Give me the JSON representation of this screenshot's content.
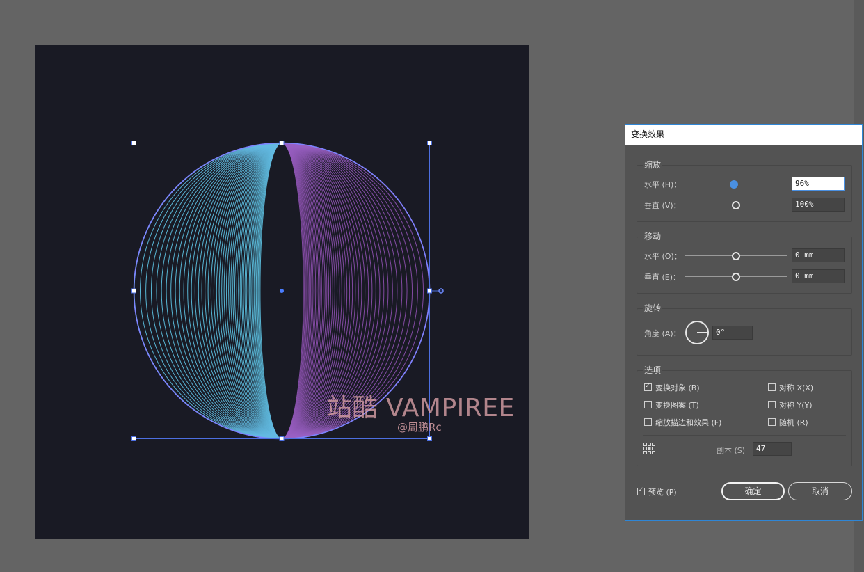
{
  "watermark": {
    "main": "站酷 VAMPIREE",
    "sub": "@周鹏Rc"
  },
  "dialog": {
    "title": "变换效果",
    "scale": {
      "title": "缩放",
      "horizontal": {
        "label": "水平 (H)：",
        "value": "96%"
      },
      "vertical": {
        "label": "垂直 (V)：",
        "value": "100%"
      }
    },
    "move": {
      "title": "移动",
      "horizontal": {
        "label": "水平 (O)：",
        "value": "0 mm"
      },
      "vertical": {
        "label": "垂直 (E)：",
        "value": "0 mm"
      }
    },
    "rotate": {
      "title": "旋转",
      "angle": {
        "label": "角度 (A)：",
        "value": "0°"
      }
    },
    "options": {
      "title": "选项",
      "transform_objects": {
        "label": "变换对象 (B)",
        "checked": true
      },
      "transform_patterns": {
        "label": "变换图案 (T)",
        "checked": false
      },
      "scale_strokes": {
        "label": "缩放描边和效果 (F)",
        "checked": false
      },
      "reflect_x": {
        "label": "对称 X(X)",
        "checked": false
      },
      "reflect_y": {
        "label": "对称 Y(Y)",
        "checked": false
      },
      "random": {
        "label": "随机 (R)",
        "checked": false
      },
      "copies": {
        "label": "副本 (S)",
        "value": "47"
      }
    },
    "preview": {
      "label": "预览 (P)",
      "checked": true
    },
    "ok_label": "确定",
    "cancel_label": "取消"
  },
  "colors": {
    "canvas_bg": "#646464",
    "artboard_bg": "#191a24",
    "gradient_left": "#5ec6e6",
    "gradient_right": "#8e4fb0",
    "outline": "#7d83ff",
    "selection": "#4d6fe0",
    "annotation_arrow": "#e83cd8",
    "focus": "#4a90e2"
  }
}
